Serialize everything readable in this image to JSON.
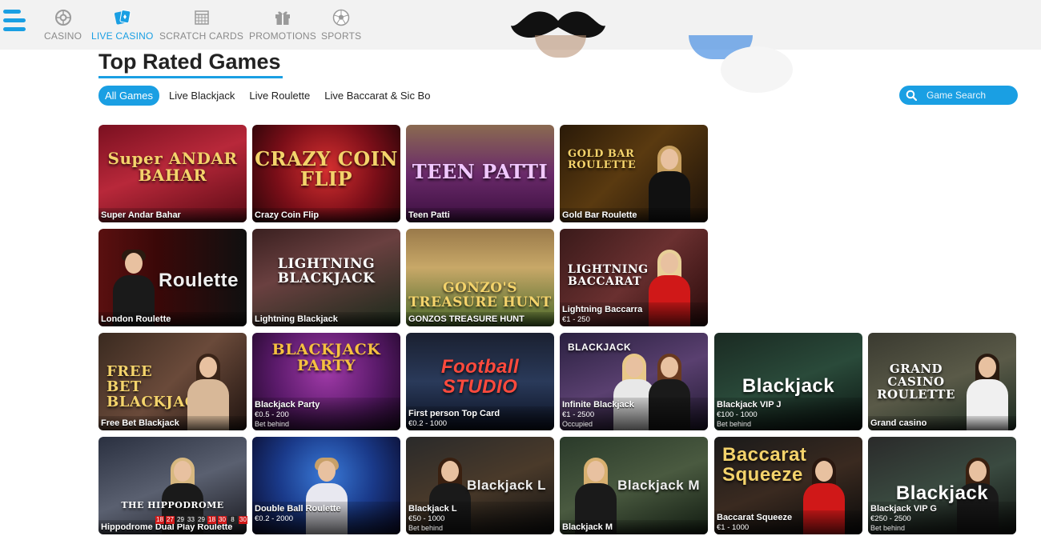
{
  "nav": {
    "items": [
      {
        "label": "CASINO",
        "icon": "roulette-wheel-icon",
        "active": false
      },
      {
        "label": "LIVE CASINO",
        "icon": "cards-icon",
        "active": true
      },
      {
        "label": "SCRATCH CARDS",
        "icon": "scratch-card-icon",
        "active": false
      },
      {
        "label": "PROMOTIONS",
        "icon": "gift-icon",
        "active": false
      },
      {
        "label": "SPORTS",
        "icon": "football-icon",
        "active": false
      }
    ],
    "logo": "mustache-logo"
  },
  "page": {
    "title": "Top Rated Games"
  },
  "filters": {
    "tabs": [
      "All Games",
      "Live Blackjack",
      "Live Roulette",
      "Live Baccarat & Sic Bo"
    ],
    "active": "All Games"
  },
  "search": {
    "placeholder": "Game Search"
  },
  "games": [
    {
      "name": "Super Andar Bahar",
      "brand": "Super ANDAR BAHAR",
      "limits": "",
      "status": ""
    },
    {
      "name": "Crazy Coin Flip",
      "brand": "CRAZY COIN FLIP",
      "limits": "",
      "status": ""
    },
    {
      "name": "Teen Patti",
      "brand": "TEEN PATTI",
      "limits": "",
      "status": ""
    },
    {
      "name": "Gold Bar Roulette",
      "brand": "GOLD BAR ROULETTE",
      "limits": "",
      "status": ""
    },
    {
      "name": "London Roulette",
      "brand": "Roulette",
      "limits": "",
      "status": ""
    },
    {
      "name": "Lightning Blackjack",
      "brand": "LIGHTNING BLACKJACK",
      "limits": "",
      "status": ""
    },
    {
      "name": "GONZOS TREASURE HUNT",
      "brand": "GONZO'S TREASURE HUNT",
      "limits": "",
      "status": ""
    },
    {
      "name": "Lightning Baccarra",
      "brand": "LIGHTNING BACCARAT",
      "limits": "€1 - 250",
      "status": ""
    },
    {
      "name": "Free Bet Blackjack",
      "brand": "FREE BET BLACKJACK",
      "limits": "",
      "status": ""
    },
    {
      "name": "Blackjack Party",
      "brand": "BLACKJACK PARTY",
      "limits": "€0.5 - 200",
      "status": "Bet behind"
    },
    {
      "name": "First person Top Card",
      "brand": "Football STUDIO",
      "limits": "€0.2 - 1000",
      "status": ""
    },
    {
      "name": "Infinite Blackjack",
      "brand": "BLACKJACK",
      "limits": "€1 - 2500",
      "status": "Occupied"
    },
    {
      "name": "Blackjack VIP J",
      "brand": "Blackjack",
      "limits": "€100 - 1000",
      "status": "Bet behind"
    },
    {
      "name": "Grand casino",
      "brand": "GRAND CASINO ROULETTE",
      "limits": "",
      "status": ""
    },
    {
      "name": "Hippodrome Dual Play Roulette",
      "brand": "THE HIPPODROME",
      "limits": "",
      "status": ""
    },
    {
      "name": "Double Ball Roulette",
      "brand": "",
      "limits": "€0.2 - 2000",
      "status": ""
    },
    {
      "name": "Blackjack L",
      "brand": "Blackjack L",
      "limits": "€50 - 1000",
      "status": "Bet behind"
    },
    {
      "name": "Blackjack M",
      "brand": "Blackjack M",
      "limits": "",
      "status": ""
    },
    {
      "name": "Baccarat Squeeze",
      "brand": "Baccarat Squeeze",
      "limits": "€1 - 1000",
      "status": ""
    },
    {
      "name": "Blackjack VIP G",
      "brand": "Blackjack",
      "limits": "€250 - 2500",
      "status": "Bet behind"
    }
  ],
  "double_ball_results": [
    "18",
    "27",
    "29",
    "33",
    "29",
    "18",
    "30",
    "8",
    "30"
  ],
  "colors": {
    "accent": "#1a9fe3",
    "topbar": "#f2f2f2"
  }
}
